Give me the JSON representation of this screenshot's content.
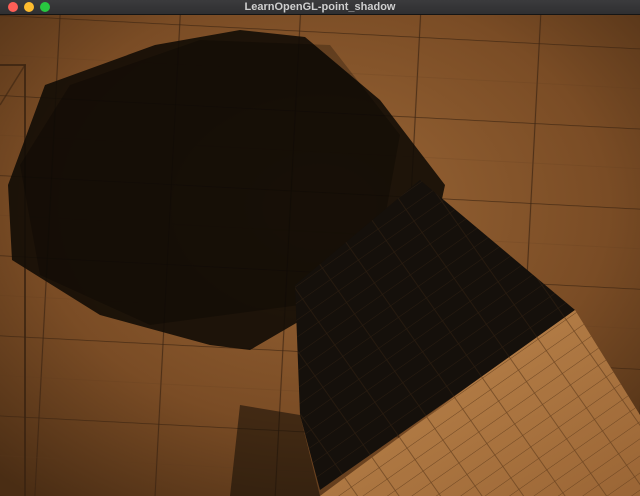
{
  "window": {
    "title": "LearnOpenGL-point_shadow"
  },
  "scene": {
    "description_icon": "opengl-render-viewport",
    "floor_color": "#8a5a30",
    "floor_dark_color": "#4d3017",
    "shadow_color": "#120c06",
    "cube_lit_color": "#b27c47",
    "cube_shadow_color": "#15100b"
  }
}
